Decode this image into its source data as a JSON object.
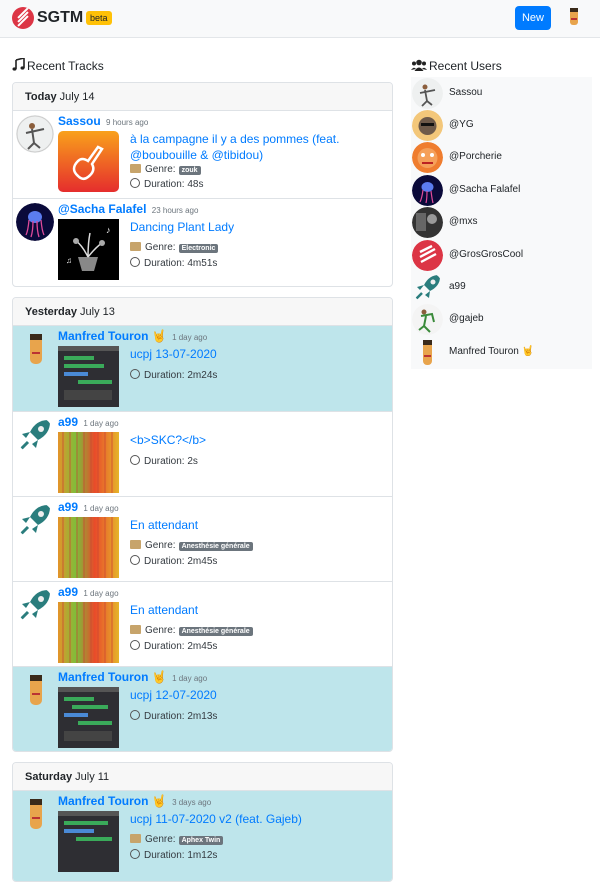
{
  "header": {
    "brand": "SGTM",
    "badge": "beta",
    "new_button": "New"
  },
  "recent_tracks": {
    "title": "Recent Tracks"
  },
  "recent_users": {
    "title": "Recent Users",
    "users": [
      "Sassou",
      "@YG",
      "@Porcherie",
      "@Sacha Falafel",
      "@mxs",
      "@GrosGrosCool",
      "a99",
      "@gajeb",
      "Manfred Touron 🤘"
    ]
  },
  "days": [
    {
      "label": "Today",
      "date": "July 14",
      "tracks": [
        {
          "user": "Sassou",
          "ago": "9 hours ago",
          "title": "à la campagne il y a des pommes (feat. @boubouille & @tibidou)",
          "genre": "zouk",
          "duration": "48s",
          "highlight": false
        },
        {
          "user": "@Sacha Falafel",
          "ago": "23 hours ago",
          "title": "Dancing Plant Lady",
          "genre": "Electronic",
          "duration": "4m51s",
          "highlight": false
        }
      ]
    },
    {
      "label": "Yesterday",
      "date": "July 13",
      "tracks": [
        {
          "user": "Manfred Touron 🤘",
          "ago": "1 day ago",
          "title": "ucpj 13-07-2020",
          "genre": "",
          "duration": "2m24s",
          "highlight": true
        },
        {
          "user": "a99",
          "ago": "1 day ago",
          "title": "<b>SKC?</b>",
          "genre": "",
          "duration": "2s",
          "highlight": false
        },
        {
          "user": "a99",
          "ago": "1 day ago",
          "title": "En attendant",
          "genre": "Anesthésie générale",
          "duration": "2m45s",
          "highlight": false
        },
        {
          "user": "a99",
          "ago": "1 day ago",
          "title": "En attendant",
          "genre": "Anesthésie générale",
          "duration": "2m45s",
          "highlight": false
        },
        {
          "user": "Manfred Touron 🤘",
          "ago": "1 day ago",
          "title": "ucpj 12-07-2020",
          "genre": "",
          "duration": "2m13s",
          "highlight": true
        }
      ]
    },
    {
      "label": "Saturday",
      "date": "July 11",
      "tracks": [
        {
          "user": "Manfred Touron 🤘",
          "ago": "3 days ago",
          "title": "ucpj 11-07-2020 v2 (feat. Gajeb)",
          "genre": "Aphex Twin",
          "duration": "1m12s",
          "highlight": true
        }
      ]
    }
  ],
  "labels": {
    "genre": "Genre:",
    "duration": "Duration:"
  },
  "colors": {
    "brand_red": "#dc3545",
    "accent": "#007bff",
    "highlight": "#bee5eb",
    "beta": "#ffc107"
  }
}
